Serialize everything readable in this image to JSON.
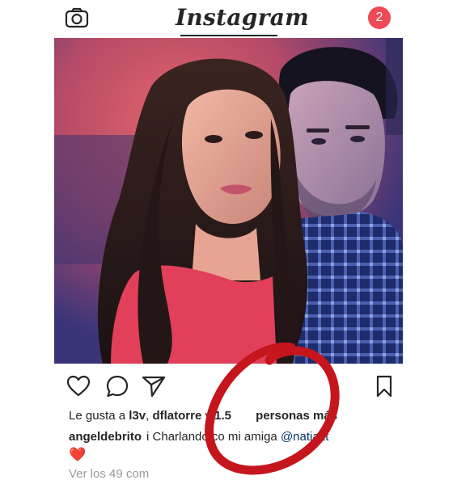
{
  "header": {
    "logo_text": "Instagram",
    "notification_count": "2",
    "icons": {
      "camera": "camera-icon"
    }
  },
  "post": {
    "photo": {
      "description_icon": "photo-image"
    },
    "actions": {
      "like": "heart-outline-icon",
      "comment": "comment-bubble-icon",
      "share": "paper-plane-icon",
      "save": "bookmark-icon"
    },
    "likes": {
      "prefix": "Le gusta a ",
      "user1": "l3v",
      "sep1": ", ",
      "user2": "dflatorre",
      "middle": " y ",
      "count": "1.5",
      "suffix": " personas más"
    },
    "caption": {
      "username": "angeldebrito",
      "text_a": "i Charlando co",
      "text_b": " mi amiga ",
      "mention": "@natjaitt"
    },
    "emoji": "❤️",
    "view_comments": "Ver los 49 com"
  },
  "colors": {
    "accent_red": "#ed4956",
    "mention_blue": "#003569",
    "text": "#262626",
    "muted": "#999999",
    "annotation_red": "#c4161c"
  }
}
